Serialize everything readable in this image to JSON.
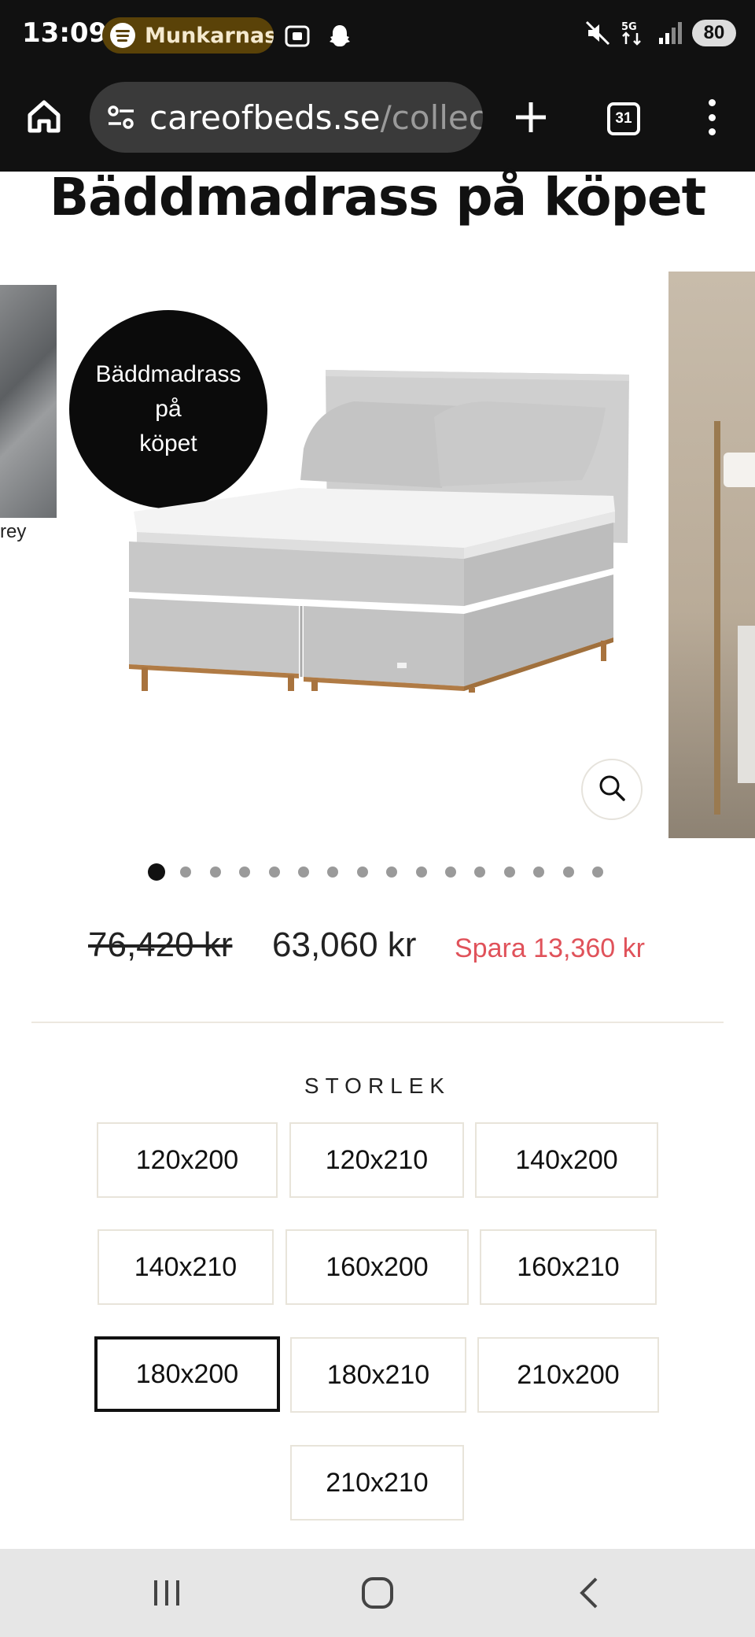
{
  "status_bar": {
    "time": "13:09",
    "spotify_label": "Munkarnas",
    "battery": "80",
    "network": "5G"
  },
  "browser": {
    "url_domain": "careofbeds.se",
    "url_path": "/collect",
    "tab_count": "31"
  },
  "page": {
    "title": "Bäddmadrass på köpet",
    "badge_text": "Bäddmadrass\npå\nköpet",
    "prev_slide_caption": "rey"
  },
  "carousel": {
    "total_slides": 16,
    "active_index": 0
  },
  "pricing": {
    "original_price": "76,420 kr",
    "current_price": "63,060 kr",
    "savings": "Spara 13,360 kr"
  },
  "size_selector": {
    "label": "STORLEK",
    "selected": "180x200",
    "options": [
      "120x200",
      "120x210",
      "140x200",
      "140x210",
      "160x200",
      "160x210",
      "180x200",
      "180x210",
      "210x200",
      "210x210"
    ]
  },
  "colors": {
    "accent_sale": "#e0525a",
    "status_bar_bg": "#111111",
    "spotify_pill": "#5a4208"
  }
}
